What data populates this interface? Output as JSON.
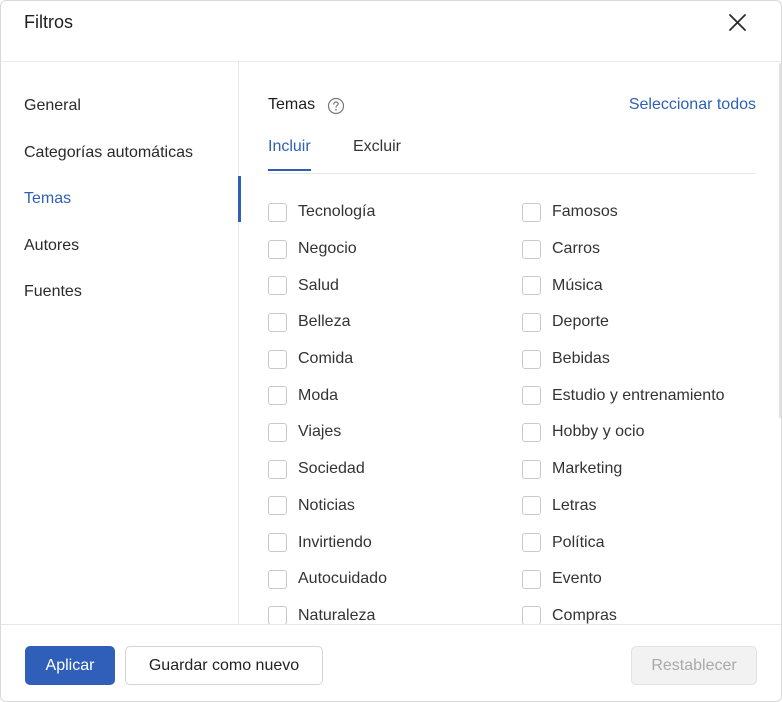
{
  "dialog": {
    "title": "Filtros"
  },
  "sidebar": {
    "items": [
      {
        "label": "General",
        "active": false
      },
      {
        "label": "Categorías automáticas",
        "active": false
      },
      {
        "label": "Temas",
        "active": true
      },
      {
        "label": "Autores",
        "active": false
      },
      {
        "label": "Fuentes",
        "active": false
      }
    ]
  },
  "section": {
    "title": "Temas",
    "select_all": "Seleccionar todos",
    "tabs": [
      {
        "label": "Incluir",
        "active": true
      },
      {
        "label": "Excluir",
        "active": false
      }
    ]
  },
  "topics": {
    "left": [
      "Tecnología",
      "Negocio",
      "Salud",
      "Belleza",
      "Comida",
      "Moda",
      "Viajes",
      "Sociedad",
      "Noticias",
      "Invirtiendo",
      "Autocuidado",
      "Naturaleza"
    ],
    "right": [
      "Famosos",
      "Carros",
      "Música",
      "Deporte",
      "Bebidas",
      "Estudio y entrenamiento",
      "Hobby y ocio",
      "Marketing",
      "Letras",
      "Política",
      "Evento",
      "Compras"
    ]
  },
  "footer": {
    "apply": "Aplicar",
    "save_new": "Guardar como nuevo",
    "reset": "Restablecer"
  },
  "colors": {
    "accent": "#2f5fb8",
    "border": "#e6e6e6",
    "disabled_text": "#a9a9a9"
  }
}
